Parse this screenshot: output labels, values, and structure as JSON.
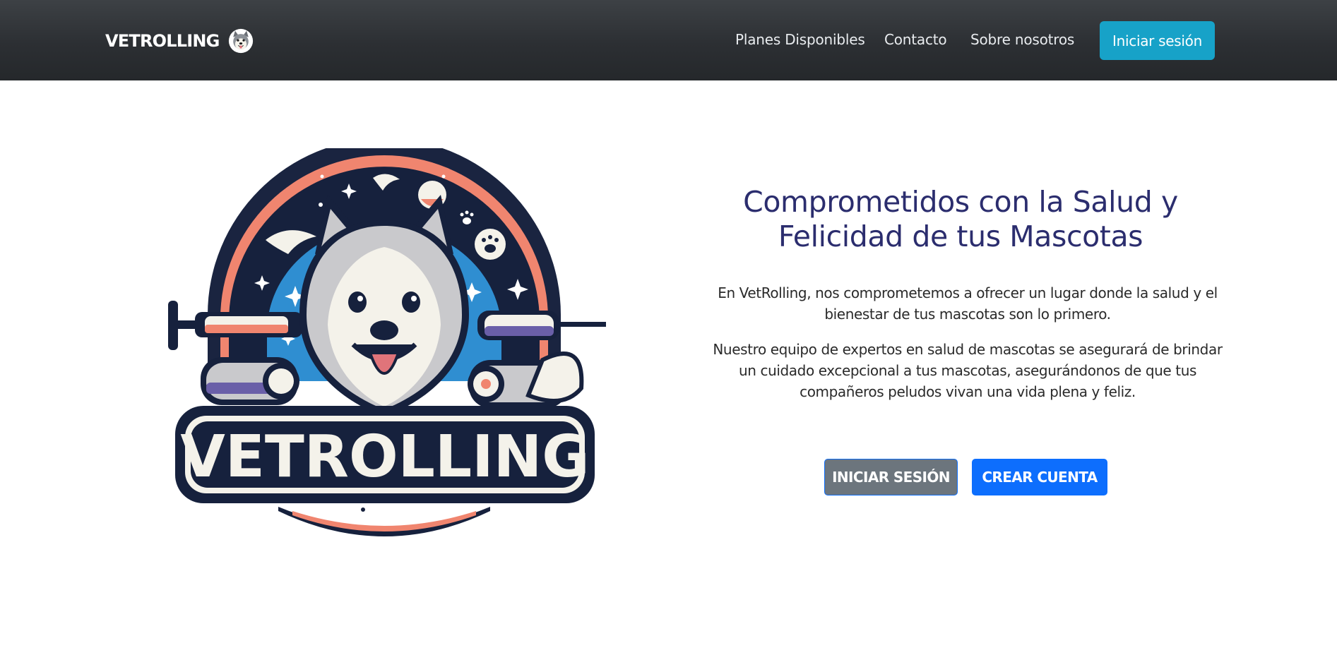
{
  "navbar": {
    "brand": "VETROLLING",
    "brand_logo_icon": "husky-dog-icon",
    "links": [
      "Planes Disponibles",
      "Contacto",
      "Sobre nosotros"
    ],
    "login_button": "Iniciar sesión",
    "login_color": "#17a2c8"
  },
  "hero": {
    "logo_text": "VETROLLING",
    "logo_icon": "vetrolling-husky-logo",
    "headline": "Comprometidos con la Salud y Felicidad de tus Mascotas",
    "paragraphs": [
      "En VetRolling, nos comprometemos a ofrecer un lugar donde la salud y el bienestar de tus mascotas son lo primero.",
      "Nuestro equipo de expertos en salud de mascotas se asegurará de brindar un cuidado excepcional a tus mascotas, asegurándonos de que tus compañeros peludos vivan una vida plena y feliz."
    ],
    "buttons": {
      "login": "INICIAR SESIÓN",
      "signup": "CREAR CUENTA"
    },
    "colors": {
      "headline": "#2b2d6e",
      "login_button": "#6c757d",
      "signup_button": "#0d6efd"
    }
  }
}
